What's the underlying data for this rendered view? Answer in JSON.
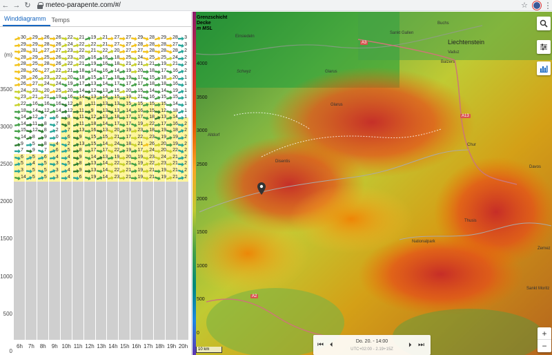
{
  "browser": {
    "url": "meteo-parapente.com/#/",
    "back_icon": "arrow-left-icon",
    "forward_icon": "arrow-right-icon",
    "reload_icon": "reload-icon"
  },
  "tabs": [
    {
      "label": "Winddiagramm",
      "active": true
    },
    {
      "label": "Temps",
      "active": false
    }
  ],
  "altitude_axis": {
    "unit": "(m)",
    "ticks": [
      "3500",
      "3000",
      "2500",
      "2000",
      "1500",
      "1000",
      "500",
      "0"
    ]
  },
  "hours": [
    "6h",
    "7h",
    "8h",
    "9h",
    "10h",
    "11h",
    "12h",
    "13h",
    "14h",
    "15h",
    "16h",
    "17h",
    "18h",
    "19h",
    "20h"
  ],
  "boundary_layer_fraction": [
    0.18,
    0.18,
    0.18,
    0.22,
    0.3,
    0.37,
    0.37,
    0.37,
    0.37,
    0.37,
    0.35,
    0.35,
    0.35,
    0.32,
    0.3
  ],
  "terrain_fraction": 0.515,
  "wind_rows": [
    [
      "30",
      "29",
      "26",
      "26",
      "22",
      "21",
      "19",
      "21",
      "27",
      "27",
      "29",
      "28",
      "29",
      "28",
      "3"
    ],
    [
      "29",
      "29",
      "28",
      "26",
      "24",
      "22",
      "22",
      "21",
      "27",
      "27",
      "28",
      "28",
      "28",
      "27",
      "3"
    ],
    [
      "28",
      "31",
      "27",
      "27",
      "23",
      "22",
      "21",
      "22",
      "20",
      "27",
      "27",
      "28",
      "28",
      "28",
      "2"
    ],
    [
      "28",
      "29",
      "25",
      "26",
      "23",
      "20",
      "16",
      "16",
      "18",
      "25",
      "24",
      "25",
      "25",
      "24",
      "2"
    ],
    [
      "28",
      "25",
      "28",
      "26",
      "22",
      "21",
      "19",
      "16",
      "18",
      "21",
      "21",
      "21",
      "19",
      "21",
      "2"
    ],
    [
      "28",
      "26",
      "27",
      "22",
      "21",
      "18",
      "14",
      "16",
      "14",
      "19",
      "20",
      "18",
      "17",
      "16",
      "2"
    ],
    [
      "28",
      "26",
      "23",
      "22",
      "20",
      "18",
      "15",
      "17",
      "18",
      "19",
      "17",
      "15",
      "18",
      "20",
      "1"
    ],
    [
      "26",
      "27",
      "24",
      "24",
      "19",
      "17",
      "13",
      "14",
      "17",
      "17",
      "17",
      "18",
      "18",
      "16",
      "1"
    ],
    [
      "24",
      "23",
      "20",
      "25",
      "20",
      "14",
      "12",
      "13",
      "15",
      "20",
      "15",
      "14",
      "14",
      "19",
      "1"
    ],
    [
      "23",
      "21",
      "21",
      "19",
      "16",
      "14",
      "13",
      "14",
      "15",
      "19",
      "21",
      "16",
      "15",
      "15",
      "1"
    ],
    [
      "22",
      "16",
      "16",
      "16",
      "12",
      "8",
      "11",
      "13",
      "13",
      "15",
      "15",
      "15",
      "15",
      "14",
      "1"
    ],
    [
      "18",
      "14",
      "12",
      "14",
      "12",
      "11",
      "9",
      "13",
      "13",
      "14",
      "16",
      "15",
      "12",
      "18",
      "1"
    ],
    [
      "14",
      "12",
      "7",
      "6",
      "9",
      "11",
      "12",
      "13",
      "18",
      "17",
      "17",
      "18",
      "13",
      "14",
      "1"
    ],
    [
      "14",
      "11",
      "8",
      "7",
      "8",
      "11",
      "18",
      "14",
      "17",
      "17",
      "19",
      "22",
      "17",
      "16",
      "2"
    ],
    [
      "15",
      "12",
      "8",
      "2",
      "7",
      "13",
      "16",
      "13",
      "20",
      "19",
      "23",
      "18",
      "19",
      "18",
      "2"
    ],
    [
      "14",
      "8",
      "9",
      "0",
      "6",
      "9",
      "15",
      "15",
      "21",
      "17",
      "22",
      "23",
      "19",
      "19",
      "2"
    ],
    [
      "9",
      "5",
      "8",
      "4",
      "2",
      "13",
      "15",
      "14",
      "24",
      "18",
      "21",
      "26",
      "20",
      "19",
      "2"
    ],
    [
      "7",
      "9",
      "7",
      "6",
      "5",
      "8",
      "17",
      "17",
      "22",
      "19",
      "17",
      "24",
      "20",
      "22",
      "2"
    ],
    [
      "6",
      "5",
      "6",
      "4",
      "4",
      "9",
      "14",
      "13",
      "19",
      "20",
      "19",
      "23",
      "24",
      "21",
      "2"
    ],
    [
      "5",
      "4",
      "5",
      "3",
      "5",
      "8",
      "13",
      "14",
      "22",
      "21",
      "19",
      "22",
      "23",
      "21",
      "2"
    ],
    [
      "3",
      "5",
      "5",
      "3",
      "4",
      "9",
      "13",
      "14",
      "22",
      "21",
      "19",
      "21",
      "19",
      "21",
      "2"
    ],
    [
      "14",
      "5",
      "5",
      "3",
      "4",
      "6",
      "19",
      "14",
      "23",
      "21",
      "19",
      "21",
      "19",
      "21",
      "2"
    ]
  ],
  "map": {
    "legend_title_line1": "Grenzschicht",
    "legend_title_line2": "Decke",
    "legend_unit": "m MSL",
    "legend_ticks": [
      "4000",
      "3500",
      "3000",
      "2500",
      "2000",
      "1500",
      "1000",
      "500",
      "0"
    ],
    "places": [
      {
        "name": "Einsiedeln"
      },
      {
        "name": "Sankt Gallen"
      },
      {
        "name": "Buchs"
      },
      {
        "name": "Liechtenstein"
      },
      {
        "name": "Schwyz"
      },
      {
        "name": "Glarus"
      },
      {
        "name": "Glarus"
      },
      {
        "name": "Vaduz"
      },
      {
        "name": "Balzers"
      },
      {
        "name": "Altdorf"
      },
      {
        "name": "Chur"
      },
      {
        "name": "Davos"
      },
      {
        "name": "Disentis"
      },
      {
        "name": "Thusis"
      },
      {
        "name": "Nationalpark"
      },
      {
        "name": "Zernez"
      },
      {
        "name": "Sankt Moritz"
      }
    ],
    "road_badges": [
      "A3",
      "A13",
      "A2"
    ],
    "scale_label": "10 km",
    "time_main": "Do. 20. - 14:00",
    "time_sub": "UTC+02:00 - 2.19+15Z",
    "controls": [
      "search-icon",
      "sliders-icon",
      "bar-chart-icon"
    ],
    "zoom_in": "+",
    "zoom_out": "−",
    "colors": {
      "accent_blue": "#1565c0",
      "boundary_yellow": "#fff59d",
      "terrain_gray": "#cfcfcf"
    }
  }
}
